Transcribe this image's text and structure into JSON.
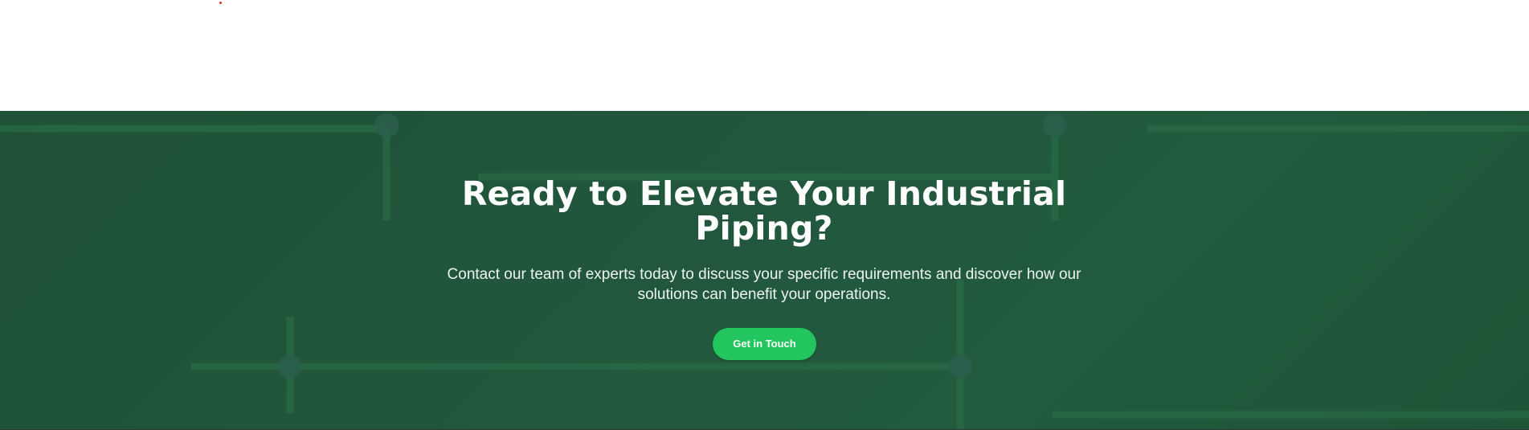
{
  "cta": {
    "heading": "Ready to Elevate Your Industrial Piping?",
    "subtext": "Contact our team of experts today to discuss your specific requirements and discover how our solutions can benefit your operations.",
    "button_label": "Get in Touch"
  },
  "colors": {
    "section_background": "#22573d",
    "pipe_lines": "#2a6b45",
    "pipe_joints": "#2b5e4c",
    "button_background": "#22c55e",
    "text": "#ffffff"
  }
}
